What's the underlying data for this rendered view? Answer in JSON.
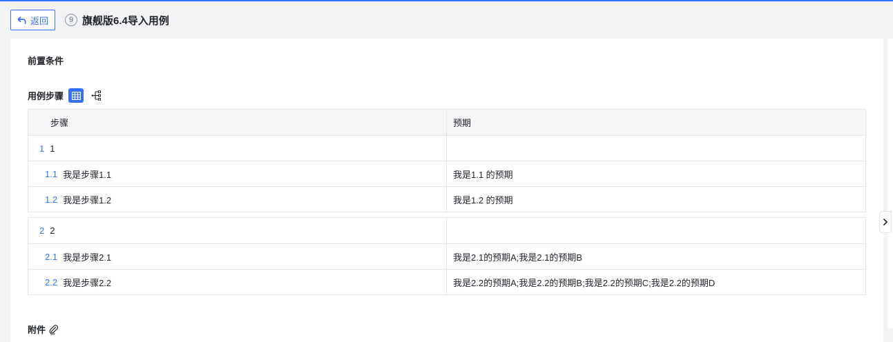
{
  "header": {
    "back_label": "返回",
    "case_number": "9",
    "case_title": "旗舰版6.4导入用例"
  },
  "preconditions": {
    "label": "前置条件"
  },
  "steps": {
    "label": "用例步骤",
    "columns": {
      "step": "步骤",
      "expected": "预期"
    },
    "groups": [
      {
        "num": "1",
        "title": "1",
        "children": [
          {
            "num": "1.1",
            "step": "我是步骤1.1",
            "expected": "我是1.1 的预期"
          },
          {
            "num": "1.2",
            "step": "我是步骤1.2",
            "expected": "我是1.2  的预期"
          }
        ]
      },
      {
        "num": "2",
        "title": "2",
        "children": [
          {
            "num": "2.1",
            "step": "我是步骤2.1",
            "expected": "我是2.1的预期A;我是2.1的预期B"
          },
          {
            "num": "2.2",
            "step": "我是步骤2.2",
            "expected": "我是2.2的预期A;我是2.2的预期B;我是2.2的预期C;我是2.2的预期D"
          }
        ]
      }
    ]
  },
  "attachments": {
    "label": "附件"
  },
  "colors": {
    "accent": "#3370ff",
    "border": "#e4e6eb",
    "header_bg": "#f5f6f7"
  },
  "icons": [
    "back-arrow-icon",
    "table-view-icon",
    "tree-view-icon",
    "paperclip-icon",
    "chevron-right-icon"
  ]
}
